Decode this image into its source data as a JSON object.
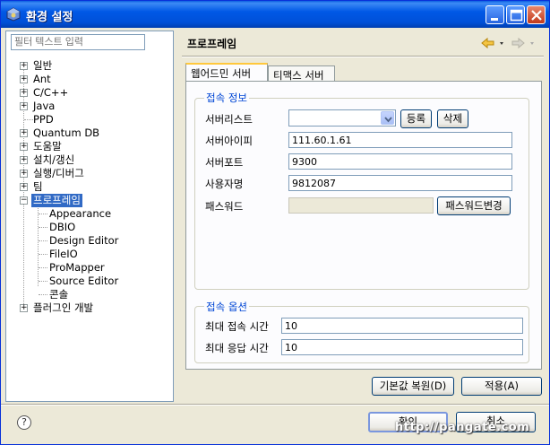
{
  "window": {
    "title": "환경 설정"
  },
  "filter": {
    "placeholder": "필터 텍스트 입력"
  },
  "tree": {
    "items": [
      {
        "label": "일반"
      },
      {
        "label": "Ant"
      },
      {
        "label": "C/C++"
      },
      {
        "label": "Java"
      },
      {
        "label": "PPD"
      },
      {
        "label": "Quantum DB"
      },
      {
        "label": "도움말"
      },
      {
        "label": "설치/갱신"
      },
      {
        "label": "실행/디버그"
      },
      {
        "label": "팀"
      },
      {
        "label": "프로프레임"
      },
      {
        "label": "Appearance"
      },
      {
        "label": "DBIO"
      },
      {
        "label": "Design Editor"
      },
      {
        "label": "FileIO"
      },
      {
        "label": "ProMapper"
      },
      {
        "label": "Source Editor"
      },
      {
        "label": "콘솔"
      },
      {
        "label": "플러그인 개발"
      }
    ]
  },
  "page": {
    "title": "프로프레임"
  },
  "tabs": [
    {
      "label": "웹어드민 서버"
    },
    {
      "label": "티맥스 서버"
    }
  ],
  "conn_info": {
    "title": "접속 정보",
    "server_list_label": "서버리스트",
    "server_list_value": "",
    "register_button": "등록",
    "delete_button": "삭제",
    "ip_label": "서버아이피",
    "ip_value": "111.60.1.61",
    "port_label": "서버포트",
    "port_value": "9300",
    "user_label": "사용자명",
    "user_value": "9812087",
    "password_label": "패스워드",
    "password_value": "",
    "change_password_button": "패스워드변경"
  },
  "conn_options": {
    "title": "접속 옵션",
    "max_conn_label": "최대 접속 시간",
    "max_conn_value": "10",
    "max_resp_label": "최대 응답 시간",
    "max_resp_value": "10"
  },
  "buttons": {
    "restore_defaults": "기본값 복원(D)",
    "apply": "적용(A)",
    "ok": "확인",
    "cancel": "취소"
  },
  "watermark": "http://pangate.com"
}
